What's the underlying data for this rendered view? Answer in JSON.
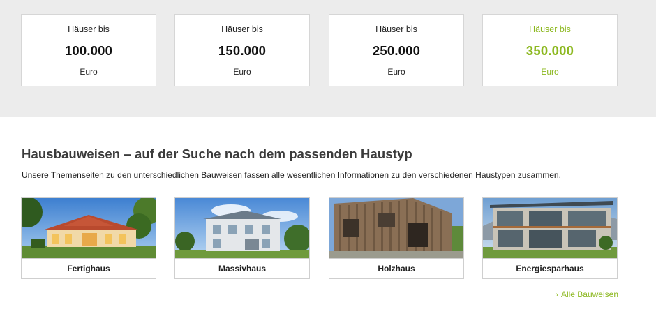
{
  "prices": [
    {
      "prefix": "Häuser bis",
      "amount": "100.000",
      "unit": "Euro"
    },
    {
      "prefix": "Häuser bis",
      "amount": "150.000",
      "unit": "Euro"
    },
    {
      "prefix": "Häuser bis",
      "amount": "250.000",
      "unit": "Euro"
    },
    {
      "prefix": "Häuser bis",
      "amount": "350.000",
      "unit": "Euro"
    }
  ],
  "section": {
    "title": "Hausbauweisen – auf der Suche nach dem passenden Haustyp",
    "description": "Unsere Themenseiten zu den unterschiedlichen Bauweisen fassen alle wesentlichen Informationen zu den verschiedenen Haustypen zusammen."
  },
  "types": [
    {
      "label": "Fertighaus"
    },
    {
      "label": "Massivhaus"
    },
    {
      "label": "Holzhaus"
    },
    {
      "label": "Energiesparhaus"
    }
  ],
  "all_link": {
    "label": "Alle Bauweisen",
    "icon": "chevron-right-icon"
  },
  "colors": {
    "accent": "#8cb81f",
    "band": "#ececec"
  }
}
